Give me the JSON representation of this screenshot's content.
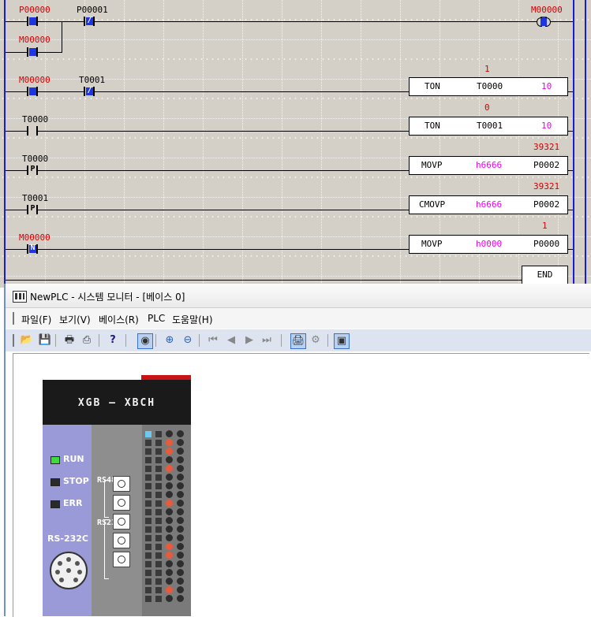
{
  "ladder": {
    "rungs": [
      {
        "contacts": [
          "P00000",
          "P00001"
        ],
        "parallel": "M00000",
        "coil": "M00000"
      },
      {
        "contacts": [
          "M00000",
          "T0001"
        ],
        "instr": "TON",
        "op1": "T0000",
        "op2": "10",
        "monitor": "1"
      },
      {
        "contacts": [
          "T0000"
        ],
        "instr": "TON",
        "op1": "T0001",
        "op2": "10",
        "monitor": "0"
      },
      {
        "contacts": [
          "T0000"
        ],
        "instr": "MOVP",
        "op1": "h6666",
        "op2": "P0002",
        "monitor": "39321"
      },
      {
        "contacts": [
          "T0001"
        ],
        "instr": "CMOVP",
        "op1": "h6666",
        "op2": "P0002",
        "monitor": "39321"
      },
      {
        "contacts": [
          "M00000"
        ],
        "instr": "MOVP",
        "op1": "h0000",
        "op2": "P0000",
        "monitor": "1"
      }
    ],
    "end_label": "END",
    "glyph_p": "P",
    "glyph_n": "N"
  },
  "window": {
    "title": "NewPLC - 시스템 모니터 - [베이스 0]",
    "menus": [
      "파일(F)",
      "보기(V)",
      "베이스(R)",
      "PLC",
      "도움말(H)"
    ],
    "toolbar_icons": [
      "open-icon",
      "save-icon",
      "print-icon",
      "print-preview-icon",
      "help-icon",
      "monitor-icon",
      "zoom-in-icon",
      "zoom-out-icon",
      "first-icon",
      "prev-icon",
      "next-icon",
      "last-icon",
      "io-icon",
      "io-sync-icon",
      "module-icon"
    ]
  },
  "plc": {
    "brand": "XGB — XBCH",
    "leds": [
      {
        "label": "RUN",
        "color": "#3ddc3d"
      },
      {
        "label": "STOP",
        "color": "#2a2a2a"
      },
      {
        "label": "ERR",
        "color": "#2a2a2a"
      }
    ],
    "rs232_label": "RS-232C",
    "rs485_vertical": "RS485",
    "rs232_vertical": "RS232C",
    "colors": {
      "accent_blue": "#1e35e6",
      "rail_blue": "#1b1bd1",
      "monitor_red": "#d40000",
      "operand_magenta": "#ee00ee"
    }
  }
}
